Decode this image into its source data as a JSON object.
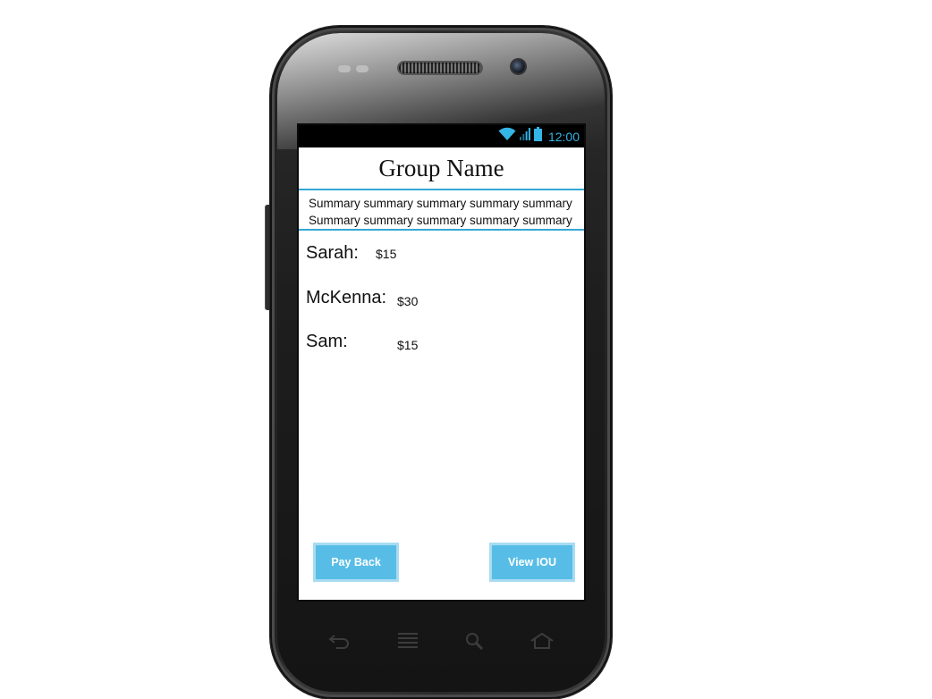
{
  "status_bar": {
    "time": "12:00",
    "icons": [
      "wifi-icon",
      "signal-icon",
      "battery-icon"
    ],
    "accent_color": "#33b5e5"
  },
  "group": {
    "title": "Group Name",
    "summary_lines": [
      "Summary summary summary summary summary",
      "Summary summary summary summary summary"
    ]
  },
  "members": [
    {
      "name": "Sarah:",
      "amount": "$15"
    },
    {
      "name": "McKenna:",
      "amount": "$30"
    },
    {
      "name": "Sam:",
      "amount": "$15"
    }
  ],
  "actions": {
    "pay_back_label": "Pay Back",
    "view_iou_label": "View IOU",
    "button_color": "#57bde7"
  },
  "hardware_nav": [
    "back-icon",
    "menu-icon",
    "search-icon",
    "home-icon"
  ]
}
